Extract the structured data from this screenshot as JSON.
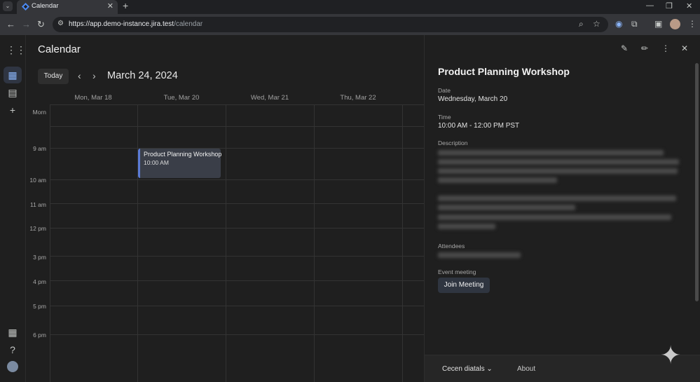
{
  "browser": {
    "tab_title": "Calendar",
    "url_host": "https://app.demo-instance.jira.test",
    "url_path": "/calendar"
  },
  "calendar": {
    "title": "Calendar",
    "today_label": "Today",
    "current_date": "March 24, 2024",
    "days": [
      "Mon, Mar 18",
      "Tue, Mar 20",
      "Wed, Mar 21",
      "Thu, Mar 22"
    ],
    "hours": [
      "Morn",
      "9 am",
      "10 am",
      "11 am",
      "12 pm",
      "3 pm",
      "4 pm",
      "5 pm",
      "6 pm"
    ],
    "event": {
      "title": "Product Planning Workshop",
      "time": "10:00 AM"
    }
  },
  "panel": {
    "title": "Product Planning Workshop",
    "date_label": "Date",
    "date_value": "Wednesday, March 20",
    "time_label": "Time",
    "time_value": "10:00 AM - 12:00 PM PST",
    "description_label": "Description",
    "attendees_label": "Attendees",
    "event_meeting_label": "Event meeting",
    "join_label": "Join Meeting",
    "footer_user": "Cecen diatals",
    "footer_about": "About"
  },
  "colors": {
    "accent": "#5b7bd6",
    "background": "#1f1f1f"
  }
}
